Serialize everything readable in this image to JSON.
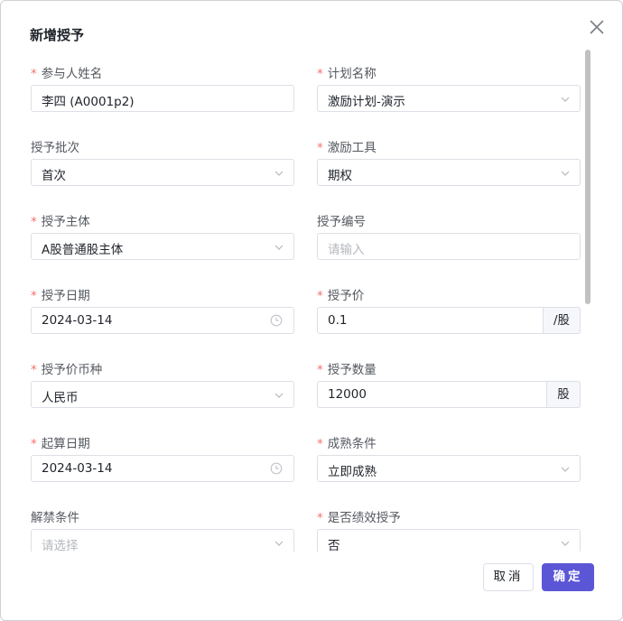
{
  "dialog": {
    "title": "新增授予",
    "cancel_label": "取消",
    "confirm_label": "确定"
  },
  "fields": {
    "participant": {
      "label": "参与人姓名",
      "value": "李四 (A0001p2)"
    },
    "plan": {
      "label": "计划名称",
      "value": "激励计划-演示"
    },
    "batch": {
      "label": "授予批次",
      "value": "首次"
    },
    "tool": {
      "label": "激励工具",
      "value": "期权"
    },
    "entity": {
      "label": "授予主体",
      "value": "A股普通股主体"
    },
    "grant_no": {
      "label": "授予编号",
      "placeholder": "请输入"
    },
    "grant_date": {
      "label": "授予日期",
      "value": "2024-03-14"
    },
    "grant_price": {
      "label": "授予价",
      "value": "0.1",
      "suffix": "/股"
    },
    "currency": {
      "label": "授予价币种",
      "value": "人民币"
    },
    "quantity": {
      "label": "授予数量",
      "value": "12000",
      "suffix": "股"
    },
    "start_date": {
      "label": "起算日期",
      "value": "2024-03-14"
    },
    "vesting": {
      "label": "成熟条件",
      "value": "立即成熟"
    },
    "unlock": {
      "label": "解禁条件",
      "placeholder": "请选择"
    },
    "performance": {
      "label": "是否绩效授予",
      "value": "否"
    }
  },
  "required_mark": "*",
  "colors": {
    "primary": "#5b56d6",
    "required": "#f5706e",
    "border": "#dcdfe6"
  }
}
